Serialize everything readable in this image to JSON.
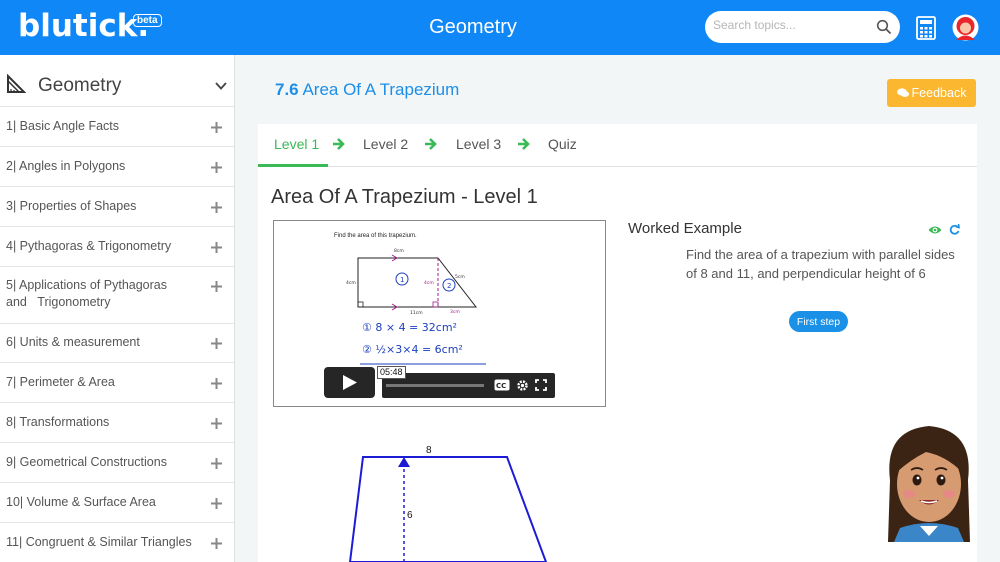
{
  "header": {
    "logo": "blutick.",
    "logo_badge": "beta",
    "title": "Geometry",
    "search_placeholder": "Search topics...",
    "icons": [
      "search-icon",
      "calculator-icon",
      "user-avatar-icon"
    ]
  },
  "sidebar": {
    "title": "Geometry",
    "items": [
      {
        "label": "1| Basic Angle Facts"
      },
      {
        "label": "2| Angles in Polygons"
      },
      {
        "label": "3| Properties of Shapes"
      },
      {
        "label": "4| Pythagoras & Trigonometry"
      },
      {
        "label": "5| Applications of Pythagoras and   Trigonometry"
      },
      {
        "label": "6| Units & measurement"
      },
      {
        "label": "7| Perimeter & Area"
      },
      {
        "label": "8| Transformations"
      },
      {
        "label": "9| Geometrical Constructions"
      },
      {
        "label": "10| Volume & Surface Area"
      },
      {
        "label": "11| Congruent & Similar Triangles"
      }
    ]
  },
  "main": {
    "lesson_number": "7.6",
    "lesson_title": "Area Of A Trapezium",
    "feedback_label": "Feedback",
    "tabs": [
      "Level 1",
      "Level 2",
      "Level 3",
      "Quiz"
    ],
    "active_tab": "Level 1",
    "level_title": "Area Of A Trapezium - Level 1",
    "video": {
      "heading": "Find the area of this trapezium.",
      "timestamp": "05:48",
      "watermark": "blutick",
      "labels": {
        "top": "8cm",
        "left": "4cm",
        "slant": "5cm",
        "bottom": "11cm",
        "height": "4cm",
        "offset": "3cm"
      },
      "work_line_1": "① 8 × 4 = 32cm²",
      "work_line_2": "② ½×3×4 = 6cm²"
    },
    "worked_example": {
      "title": "Worked Example",
      "question": "Find the area of a trapezium with parallel sides of 8 and 11, and perpendicular height of 6",
      "first_step_label": "First step"
    },
    "figure": {
      "top_label": "8",
      "height_label": "6"
    }
  },
  "colors": {
    "header_blue": "#0f87f7",
    "accent_green": "#3cb957",
    "feedback_orange": "#fbb72f",
    "link_blue": "#1c8ee8"
  }
}
